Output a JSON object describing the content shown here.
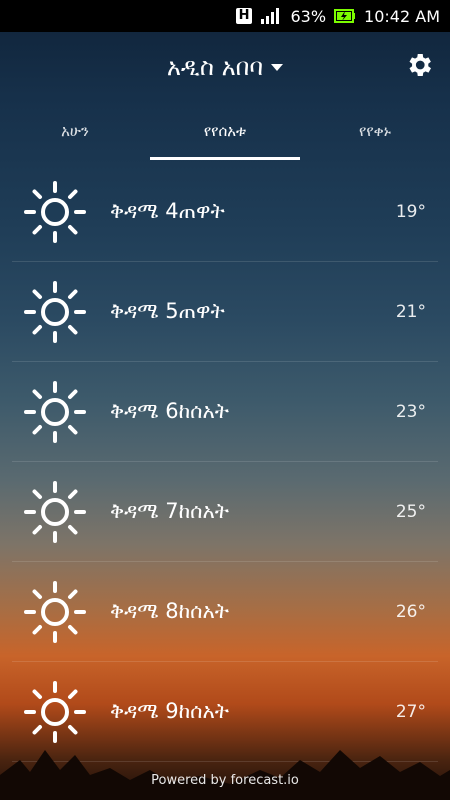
{
  "status": {
    "network_badge": "H",
    "battery": "63%",
    "time": "10:42 AM"
  },
  "header": {
    "city": "አዲስ አበባ"
  },
  "tabs": [
    {
      "label": "አሁን"
    },
    {
      "label": "የየሰአቱ"
    },
    {
      "label": "የየቀኑ"
    }
  ],
  "hours": [
    {
      "label": "ቅዳሜ 4ጠዋት",
      "temp": "19°",
      "icon": "sun-icon"
    },
    {
      "label": "ቅዳሜ 5ጠዋት",
      "temp": "21°",
      "icon": "sun-icon"
    },
    {
      "label": "ቅዳሜ 6ከሰአት",
      "temp": "23°",
      "icon": "sun-icon"
    },
    {
      "label": "ቅዳሜ 7ከሰአት",
      "temp": "25°",
      "icon": "sun-icon"
    },
    {
      "label": "ቅዳሜ 8ከሰአት",
      "temp": "26°",
      "icon": "sun-icon"
    },
    {
      "label": "ቅዳሜ 9ከሰአት",
      "temp": "27°",
      "icon": "sun-icon"
    }
  ],
  "footer": {
    "text": "Powered by forecast.io"
  },
  "colors": {
    "accent": "#ffffff",
    "battery": "#7CFC00"
  }
}
